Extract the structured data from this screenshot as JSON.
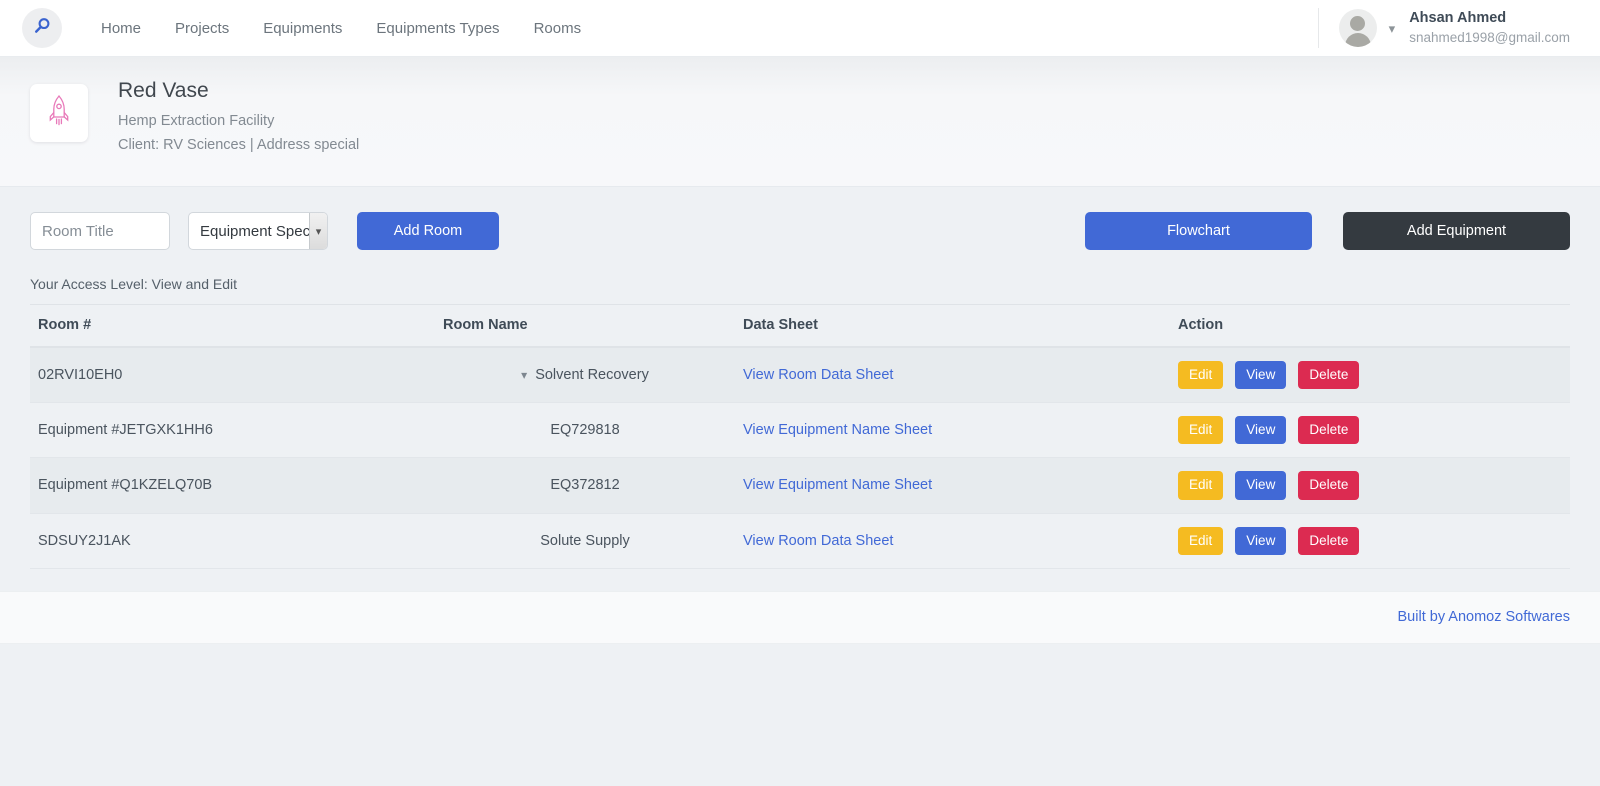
{
  "navbar": {
    "logo_icon": "search-icon",
    "links": [
      {
        "label": "Home"
      },
      {
        "label": "Projects"
      },
      {
        "label": "Equipments"
      },
      {
        "label": "Equipments Types"
      },
      {
        "label": "Rooms"
      }
    ],
    "user": {
      "name": "Ahsan Ahmed",
      "email": "snahmed1998@gmail.com",
      "caret_icon": "chevron-down-icon",
      "avatar_icon": "avatar-icon"
    }
  },
  "project": {
    "icon": "rocket-icon",
    "icon_color": "#e879b9",
    "title": "Red Vase",
    "subtitle": "Hemp Extraction Facility",
    "client_line": "Client: RV Sciences | Address special"
  },
  "toolbar": {
    "room_title_placeholder": "Room Title",
    "room_title_value": "",
    "equipment_select_value": "Equipment Spec",
    "equipment_select_options": [
      "Equipment Spec"
    ],
    "add_room_label": "Add Room",
    "flowchart_label": "Flowchart",
    "add_equipment_label": "Add Equipment",
    "primary_color": "#4169d6",
    "dark_color": "#343a40"
  },
  "access_level": "Your Access Level: View and Edit",
  "table": {
    "headers": {
      "room_no": "Room #",
      "room_name": "Room Name",
      "data_sheet": "Data Sheet",
      "action": "Action"
    },
    "action_labels": {
      "edit": "Edit",
      "view": "View",
      "delete": "Delete"
    },
    "action_colors": {
      "edit": "#f5bb21",
      "view": "#4169d6",
      "delete": "#dc2b51"
    },
    "rows": [
      {
        "room_no": "02RVI10EH0",
        "room_name": "Solvent Recovery",
        "has_chevron": true,
        "chevron_icon": "chevron-down-icon",
        "data_sheet": "View Room Data Sheet"
      },
      {
        "room_no": "Equipment #JETGXK1HH6",
        "room_name": "EQ729818",
        "has_chevron": false,
        "data_sheet": "View Equipment Name Sheet"
      },
      {
        "room_no": "Equipment #Q1KZELQ70B",
        "room_name": "EQ372812",
        "has_chevron": false,
        "data_sheet": "View Equipment Name Sheet"
      },
      {
        "room_no": "SDSUY2J1AK",
        "room_name": "Solute Supply",
        "has_chevron": false,
        "data_sheet": "View Room Data Sheet"
      }
    ]
  },
  "footer": {
    "credit": "Built by Anomoz Softwares"
  }
}
